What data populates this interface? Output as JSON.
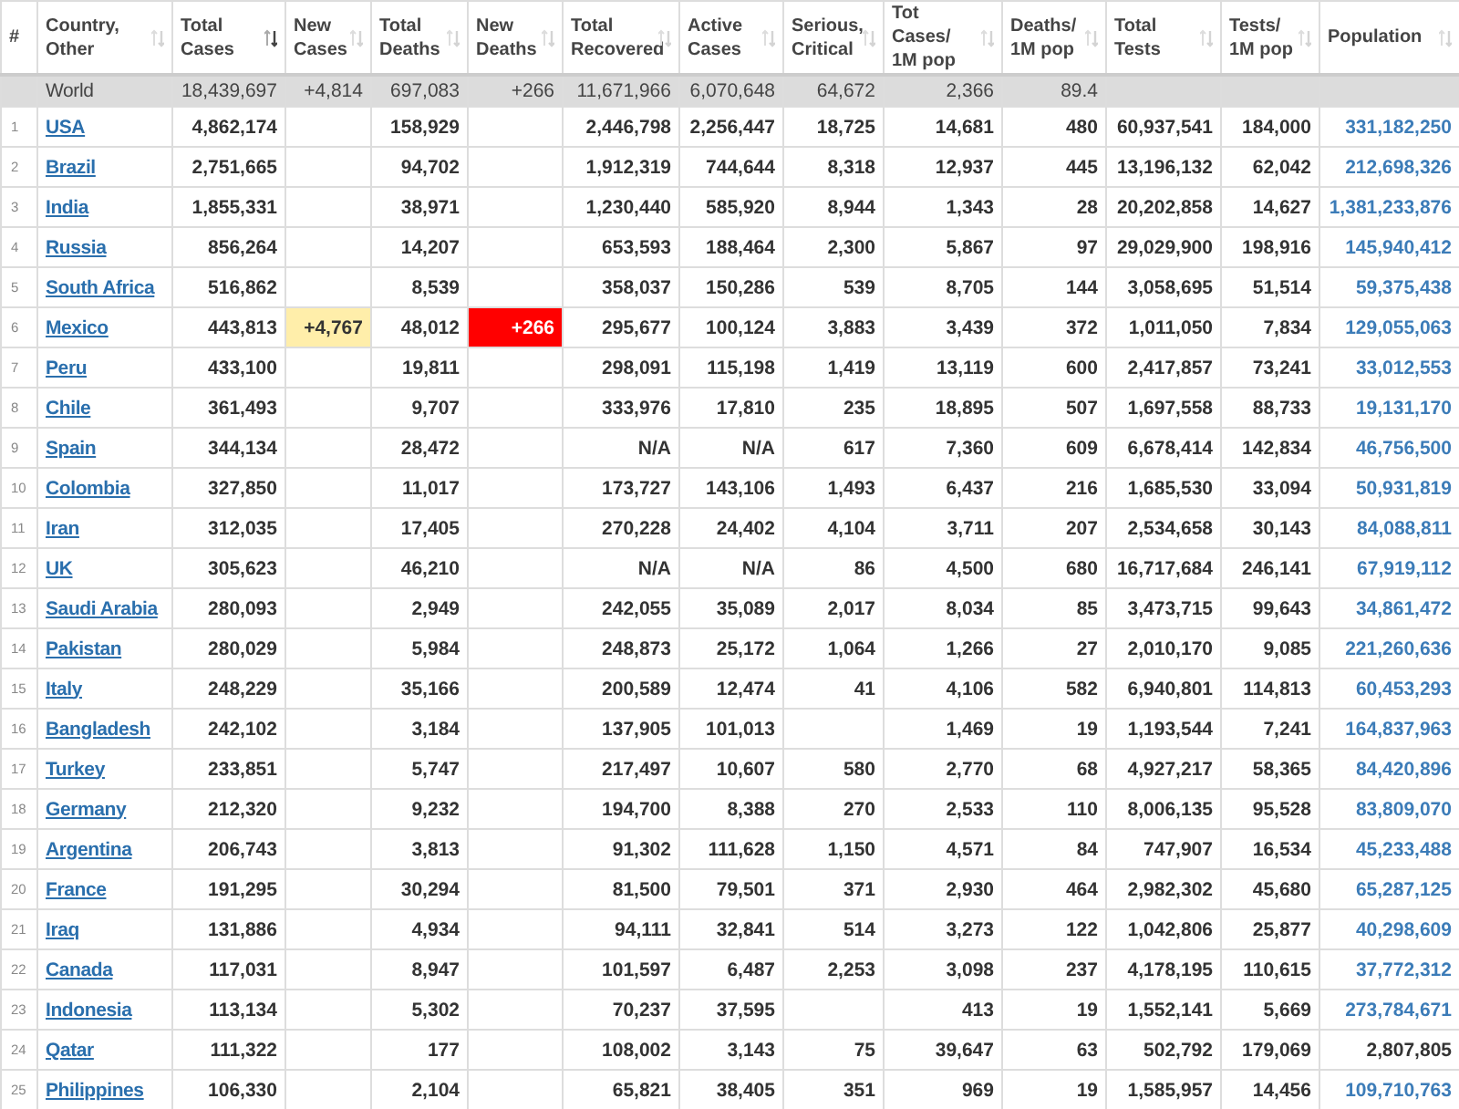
{
  "table": {
    "columns": [
      {
        "label": "#",
        "sortable": false
      },
      {
        "label": "Country,\nOther",
        "sorted": false,
        "sortable": true
      },
      {
        "label": "Total\nCases",
        "sorted": true,
        "sortable": true
      },
      {
        "label": "New\nCases",
        "sorted": false,
        "sortable": true
      },
      {
        "label": "Total\nDeaths",
        "sorted": false,
        "sortable": true
      },
      {
        "label": "New\nDeaths",
        "sorted": false,
        "sortable": true
      },
      {
        "label": "Total\nRecovered",
        "sorted": false,
        "sortable": true
      },
      {
        "label": "Active\nCases",
        "sorted": false,
        "sortable": true
      },
      {
        "label": "Serious,\nCritical",
        "sorted": false,
        "sortable": true
      },
      {
        "label": "Tot Cases/\n1M pop",
        "sorted": false,
        "sortable": true
      },
      {
        "label": "Deaths/\n1M pop",
        "sorted": false,
        "sortable": true
      },
      {
        "label": "Total\nTests",
        "sorted": false,
        "sortable": true
      },
      {
        "label": "Tests/\n1M pop",
        "sorted": false,
        "sortable": true
      },
      {
        "label": "Population",
        "sorted": false,
        "sortable": true
      }
    ],
    "world": {
      "country": "World",
      "total_cases": "18,439,697",
      "new_cases": "+4,814",
      "total_deaths": "697,083",
      "new_deaths": "+266",
      "total_recovered": "11,671,966",
      "active_cases": "6,070,648",
      "serious_critical": "64,672",
      "cases_per_1m": "2,366",
      "deaths_per_1m": "89.4"
    },
    "rows": [
      {
        "rank": "1",
        "country": "USA",
        "total_cases": "4,862,174",
        "total_deaths": "158,929",
        "total_recovered": "2,446,798",
        "active_cases": "2,256,447",
        "serious_critical": "18,725",
        "cases_per_1m": "14,681",
        "deaths_per_1m": "480",
        "total_tests": "60,937,541",
        "tests_per_1m": "184,000",
        "population": "331,182,250",
        "population_link": true
      },
      {
        "rank": "2",
        "country": "Brazil",
        "total_cases": "2,751,665",
        "total_deaths": "94,702",
        "total_recovered": "1,912,319",
        "active_cases": "744,644",
        "serious_critical": "8,318",
        "cases_per_1m": "12,937",
        "deaths_per_1m": "445",
        "total_tests": "13,196,132",
        "tests_per_1m": "62,042",
        "population": "212,698,326",
        "population_link": true
      },
      {
        "rank": "3",
        "country": "India",
        "total_cases": "1,855,331",
        "total_deaths": "38,971",
        "total_recovered": "1,230,440",
        "active_cases": "585,920",
        "serious_critical": "8,944",
        "cases_per_1m": "1,343",
        "deaths_per_1m": "28",
        "total_tests": "20,202,858",
        "tests_per_1m": "14,627",
        "population": "1,381,233,876",
        "population_link": true
      },
      {
        "rank": "4",
        "country": "Russia",
        "total_cases": "856,264",
        "total_deaths": "14,207",
        "total_recovered": "653,593",
        "active_cases": "188,464",
        "serious_critical": "2,300",
        "cases_per_1m": "5,867",
        "deaths_per_1m": "97",
        "total_tests": "29,029,900",
        "tests_per_1m": "198,916",
        "population": "145,940,412",
        "population_link": true
      },
      {
        "rank": "5",
        "country": "South Africa",
        "total_cases": "516,862",
        "total_deaths": "8,539",
        "total_recovered": "358,037",
        "active_cases": "150,286",
        "serious_critical": "539",
        "cases_per_1m": "8,705",
        "deaths_per_1m": "144",
        "total_tests": "3,058,695",
        "tests_per_1m": "51,514",
        "population": "59,375,438",
        "population_link": true
      },
      {
        "rank": "6",
        "country": "Mexico",
        "total_cases": "443,813",
        "new_cases": "+4,767",
        "total_deaths": "48,012",
        "new_deaths": "+266",
        "total_recovered": "295,677",
        "active_cases": "100,124",
        "serious_critical": "3,883",
        "cases_per_1m": "3,439",
        "deaths_per_1m": "372",
        "total_tests": "1,011,050",
        "tests_per_1m": "7,834",
        "population": "129,055,063",
        "population_link": true
      },
      {
        "rank": "7",
        "country": "Peru",
        "total_cases": "433,100",
        "total_deaths": "19,811",
        "total_recovered": "298,091",
        "active_cases": "115,198",
        "serious_critical": "1,419",
        "cases_per_1m": "13,119",
        "deaths_per_1m": "600",
        "total_tests": "2,417,857",
        "tests_per_1m": "73,241",
        "population": "33,012,553",
        "population_link": true
      },
      {
        "rank": "8",
        "country": "Chile",
        "total_cases": "361,493",
        "total_deaths": "9,707",
        "total_recovered": "333,976",
        "active_cases": "17,810",
        "serious_critical": "235",
        "cases_per_1m": "18,895",
        "deaths_per_1m": "507",
        "total_tests": "1,697,558",
        "tests_per_1m": "88,733",
        "population": "19,131,170",
        "population_link": true
      },
      {
        "rank": "9",
        "country": "Spain",
        "total_cases": "344,134",
        "total_deaths": "28,472",
        "total_recovered": "N/A",
        "active_cases": "N/A",
        "serious_critical": "617",
        "cases_per_1m": "7,360",
        "deaths_per_1m": "609",
        "total_tests": "6,678,414",
        "tests_per_1m": "142,834",
        "population": "46,756,500",
        "population_link": true
      },
      {
        "rank": "10",
        "country": "Colombia",
        "total_cases": "327,850",
        "total_deaths": "11,017",
        "total_recovered": "173,727",
        "active_cases": "143,106",
        "serious_critical": "1,493",
        "cases_per_1m": "6,437",
        "deaths_per_1m": "216",
        "total_tests": "1,685,530",
        "tests_per_1m": "33,094",
        "population": "50,931,819",
        "population_link": true
      },
      {
        "rank": "11",
        "country": "Iran",
        "total_cases": "312,035",
        "total_deaths": "17,405",
        "total_recovered": "270,228",
        "active_cases": "24,402",
        "serious_critical": "4,104",
        "cases_per_1m": "3,711",
        "deaths_per_1m": "207",
        "total_tests": "2,534,658",
        "tests_per_1m": "30,143",
        "population": "84,088,811",
        "population_link": true
      },
      {
        "rank": "12",
        "country": "UK",
        "total_cases": "305,623",
        "total_deaths": "46,210",
        "total_recovered": "N/A",
        "active_cases": "N/A",
        "serious_critical": "86",
        "cases_per_1m": "4,500",
        "deaths_per_1m": "680",
        "total_tests": "16,717,684",
        "tests_per_1m": "246,141",
        "population": "67,919,112",
        "population_link": true
      },
      {
        "rank": "13",
        "country": "Saudi Arabia",
        "total_cases": "280,093",
        "total_deaths": "2,949",
        "total_recovered": "242,055",
        "active_cases": "35,089",
        "serious_critical": "2,017",
        "cases_per_1m": "8,034",
        "deaths_per_1m": "85",
        "total_tests": "3,473,715",
        "tests_per_1m": "99,643",
        "population": "34,861,472",
        "population_link": true
      },
      {
        "rank": "14",
        "country": "Pakistan",
        "total_cases": "280,029",
        "total_deaths": "5,984",
        "total_recovered": "248,873",
        "active_cases": "25,172",
        "serious_critical": "1,064",
        "cases_per_1m": "1,266",
        "deaths_per_1m": "27",
        "total_tests": "2,010,170",
        "tests_per_1m": "9,085",
        "population": "221,260,636",
        "population_link": true
      },
      {
        "rank": "15",
        "country": "Italy",
        "total_cases": "248,229",
        "total_deaths": "35,166",
        "total_recovered": "200,589",
        "active_cases": "12,474",
        "serious_critical": "41",
        "cases_per_1m": "4,106",
        "deaths_per_1m": "582",
        "total_tests": "6,940,801",
        "tests_per_1m": "114,813",
        "population": "60,453,293",
        "population_link": true
      },
      {
        "rank": "16",
        "country": "Bangladesh",
        "total_cases": "242,102",
        "total_deaths": "3,184",
        "total_recovered": "137,905",
        "active_cases": "101,013",
        "cases_per_1m": "1,469",
        "deaths_per_1m": "19",
        "total_tests": "1,193,544",
        "tests_per_1m": "7,241",
        "population": "164,837,963",
        "population_link": true
      },
      {
        "rank": "17",
        "country": "Turkey",
        "total_cases": "233,851",
        "total_deaths": "5,747",
        "total_recovered": "217,497",
        "active_cases": "10,607",
        "serious_critical": "580",
        "cases_per_1m": "2,770",
        "deaths_per_1m": "68",
        "total_tests": "4,927,217",
        "tests_per_1m": "58,365",
        "population": "84,420,896",
        "population_link": true
      },
      {
        "rank": "18",
        "country": "Germany",
        "total_cases": "212,320",
        "total_deaths": "9,232",
        "total_recovered": "194,700",
        "active_cases": "8,388",
        "serious_critical": "270",
        "cases_per_1m": "2,533",
        "deaths_per_1m": "110",
        "total_tests": "8,006,135",
        "tests_per_1m": "95,528",
        "population": "83,809,070",
        "population_link": true
      },
      {
        "rank": "19",
        "country": "Argentina",
        "total_cases": "206,743",
        "total_deaths": "3,813",
        "total_recovered": "91,302",
        "active_cases": "111,628",
        "serious_critical": "1,150",
        "cases_per_1m": "4,571",
        "deaths_per_1m": "84",
        "total_tests": "747,907",
        "tests_per_1m": "16,534",
        "population": "45,233,488",
        "population_link": true
      },
      {
        "rank": "20",
        "country": "France",
        "total_cases": "191,295",
        "total_deaths": "30,294",
        "total_recovered": "81,500",
        "active_cases": "79,501",
        "serious_critical": "371",
        "cases_per_1m": "2,930",
        "deaths_per_1m": "464",
        "total_tests": "2,982,302",
        "tests_per_1m": "45,680",
        "population": "65,287,125",
        "population_link": true
      },
      {
        "rank": "21",
        "country": "Iraq",
        "total_cases": "131,886",
        "total_deaths": "4,934",
        "total_recovered": "94,111",
        "active_cases": "32,841",
        "serious_critical": "514",
        "cases_per_1m": "3,273",
        "deaths_per_1m": "122",
        "total_tests": "1,042,806",
        "tests_per_1m": "25,877",
        "population": "40,298,609",
        "population_link": true
      },
      {
        "rank": "22",
        "country": "Canada",
        "total_cases": "117,031",
        "total_deaths": "8,947",
        "total_recovered": "101,597",
        "active_cases": "6,487",
        "serious_critical": "2,253",
        "cases_per_1m": "3,098",
        "deaths_per_1m": "237",
        "total_tests": "4,178,195",
        "tests_per_1m": "110,615",
        "population": "37,772,312",
        "population_link": true
      },
      {
        "rank": "23",
        "country": "Indonesia",
        "total_cases": "113,134",
        "total_deaths": "5,302",
        "total_recovered": "70,237",
        "active_cases": "37,595",
        "cases_per_1m": "413",
        "deaths_per_1m": "19",
        "total_tests": "1,552,141",
        "tests_per_1m": "5,669",
        "population": "273,784,671",
        "population_link": true
      },
      {
        "rank": "24",
        "country": "Qatar",
        "total_cases": "111,322",
        "total_deaths": "177",
        "total_recovered": "108,002",
        "active_cases": "3,143",
        "serious_critical": "75",
        "cases_per_1m": "39,647",
        "deaths_per_1m": "63",
        "total_tests": "502,792",
        "tests_per_1m": "179,069",
        "population": "2,807,805",
        "population_link": false
      },
      {
        "rank": "25",
        "country": "Philippines",
        "total_cases": "106,330",
        "total_deaths": "2,104",
        "total_recovered": "65,821",
        "active_cases": "38,405",
        "serious_critical": "351",
        "cases_per_1m": "969",
        "deaths_per_1m": "19",
        "total_tests": "1,585,957",
        "tests_per_1m": "14,456",
        "population": "109,710,763",
        "population_link": true
      }
    ]
  }
}
